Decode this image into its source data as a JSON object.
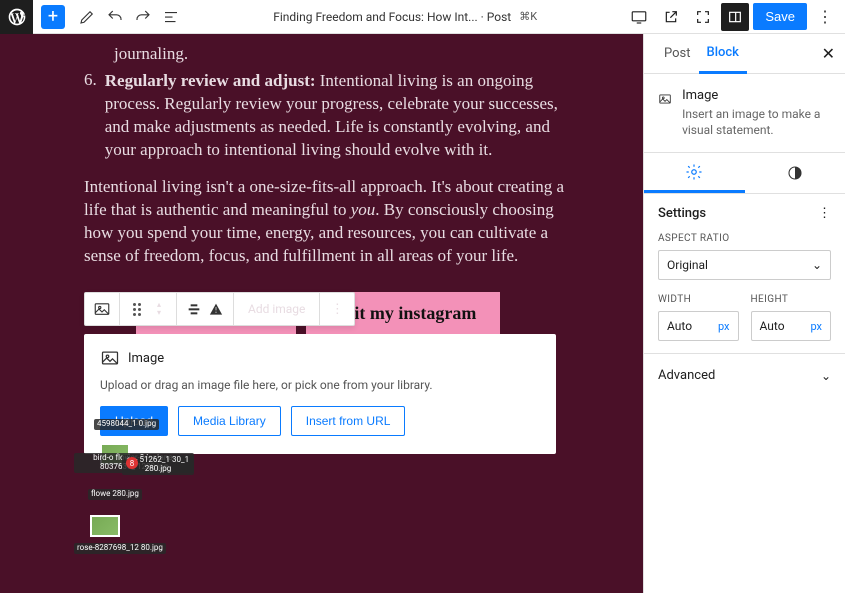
{
  "topbar": {
    "title": "Finding Freedom and Focus: How Int... · Post",
    "shortcut": "⌘K",
    "save": "Save"
  },
  "content": {
    "journaling_trail": "journaling.",
    "item6_num": "6.",
    "item6_bold": "Regularly review and adjust:",
    "item6_rest": " Intentional living is an ongoing process. Regularly review your progress, celebrate your successes, and make adjustments as needed. Life is constantly evolving, and your approach to intentional living should evolve with it.",
    "para_a": "Intentional living isn't a one-size-fits-all approach. It's about creating a life that is authentic and meaningful to ",
    "para_i": "you",
    "para_b": ". By consciously choosing how you spend your time, energy, and resources, you can cultivate a sense of freedom, focus, and fulfillment in all areas of your life.",
    "cta2": "Visit my instagram"
  },
  "float_toolbar": {
    "add_image": "Add image"
  },
  "image_block": {
    "title": "Image",
    "desc": "Upload or drag an image file here, or pick one from your library.",
    "upload": "Upload",
    "media_library": "Media Library",
    "insert_url": "Insert from URL"
  },
  "files": {
    "badge": "8",
    "f1": "4598044_1\n0.jpg",
    "f2": "bird-o\nflower-8\nlantana-8037636_\n1280.jpg",
    "f3": "se-\n51262_1\n30_1\n280.jpg",
    "f4": "flowe 280.jpg",
    "f5": "rose-8287698_12\n80.jpg"
  },
  "sidebar": {
    "tab_post": "Post",
    "tab_block": "Block",
    "block_name": "Image",
    "block_desc": "Insert an image to make a visual statement.",
    "settings_h": "Settings",
    "aspect_label": "ASPECT RATIO",
    "aspect_value": "Original",
    "width_label": "WIDTH",
    "height_label": "HEIGHT",
    "auto": "Auto",
    "unit": "px",
    "advanced": "Advanced"
  }
}
